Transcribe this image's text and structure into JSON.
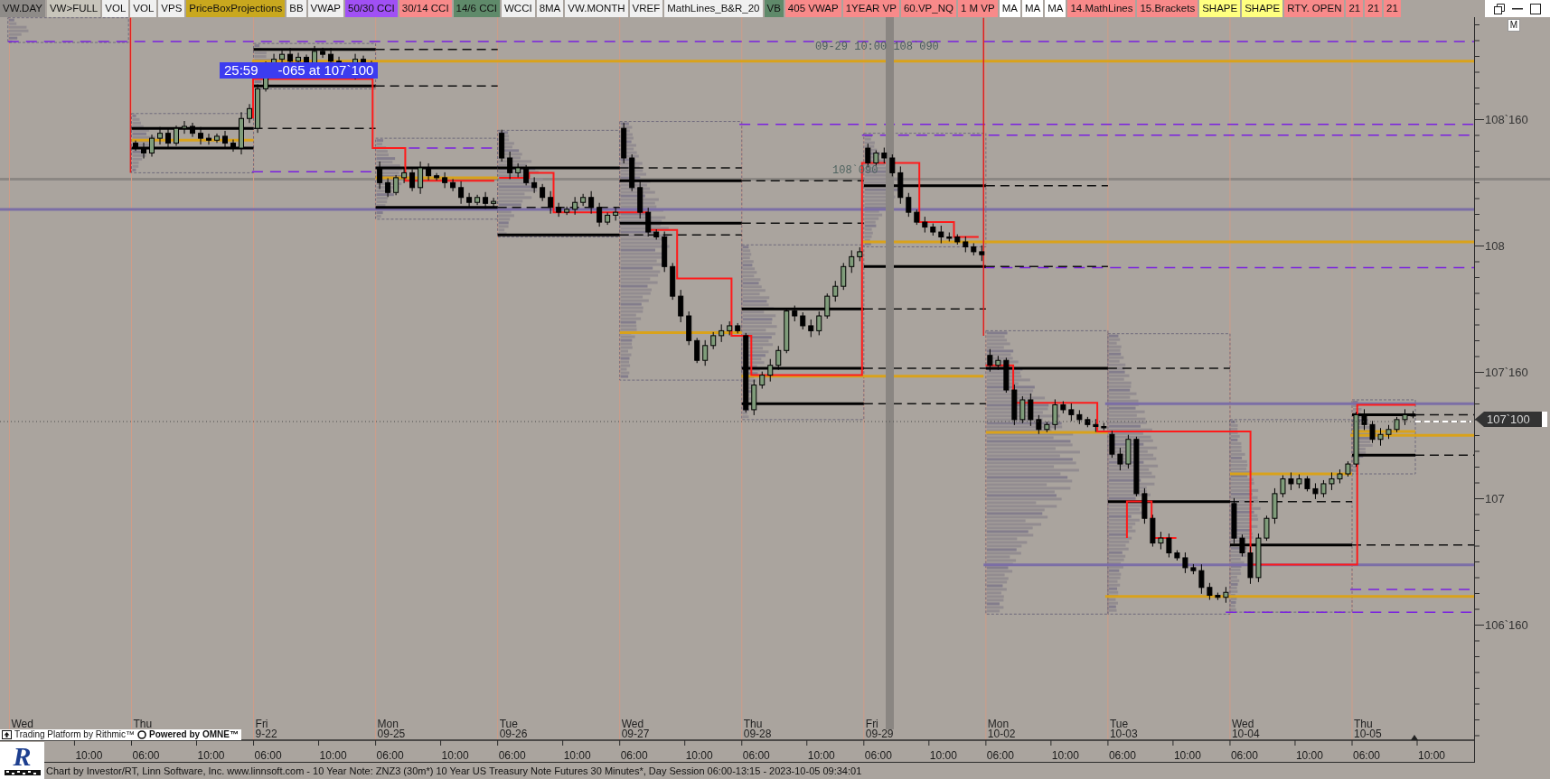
{
  "toolbar": {
    "buttons": [
      {
        "label": "VW.DAY",
        "color": "#8e8b88"
      },
      {
        "label": "VW>FULL",
        "color": "#c8c5bb"
      },
      {
        "label": "VOL",
        "color": "#f0f0f0"
      },
      {
        "label": "VOL",
        "color": "#f0f0f0"
      },
      {
        "label": "VPS",
        "color": "#f0f0f0"
      },
      {
        "label": "PriceBoxProjections",
        "color": "#c9a81e"
      },
      {
        "label": "BB",
        "color": "#f0f0f0"
      },
      {
        "label": "VWAP",
        "color": "#f0f0f0"
      },
      {
        "label": "50/30 CCI",
        "color": "#a050f5"
      },
      {
        "label": "30/14 CCI",
        "color": "#f88a8a"
      },
      {
        "label": "14/6 CCI",
        "color": "#5f8a6a"
      },
      {
        "label": "WCCI",
        "color": "#f0f0f0"
      },
      {
        "label": "8MA",
        "color": "#f0f0f0"
      },
      {
        "label": "VW.MONTH",
        "color": "#f0f0f0"
      },
      {
        "label": "VREF",
        "color": "#f0f0f0"
      },
      {
        "label": "MathLines_B&R_20",
        "color": "#f0f0f0"
      },
      {
        "label": "VB",
        "color": "#5f8a6a"
      },
      {
        "label": "405 VWAP",
        "color": "#f88a8a"
      },
      {
        "label": "1YEAR VP",
        "color": "#f88a8a"
      },
      {
        "label": "60.VP_NQ",
        "color": "#f88a8a"
      },
      {
        "label": "1 M VP",
        "color": "#f88a8a"
      },
      {
        "label": "MA",
        "color": "#ffffff"
      },
      {
        "label": "MA",
        "color": "#ffffff"
      },
      {
        "label": "MA",
        "color": "#ffffff"
      },
      {
        "label": "14.MathLines",
        "color": "#f88a8a"
      },
      {
        "label": "15.Brackets",
        "color": "#f88a8a"
      },
      {
        "label": "SHAPE",
        "color": "#ffff80"
      },
      {
        "label": "SHAPE",
        "color": "#ffff80"
      },
      {
        "label": "RTY. OPEN",
        "color": "#f88a8a"
      },
      {
        "label": "21",
        "color": "#f88a8a"
      },
      {
        "label": "21",
        "color": "#f88a8a"
      },
      {
        "label": "21",
        "color": "#f88a8a"
      }
    ]
  },
  "chart": {
    "countdown_label": {
      "time": "25:59",
      "text": "-065 at 107`100"
    },
    "annotations": [
      "09-29 10:00 108`090",
      "108`090"
    ]
  },
  "price_axis": {
    "button": "M",
    "labels": [
      "108`160",
      "108",
      "107`160",
      "107",
      "106`160"
    ],
    "current_price": "107`100"
  },
  "time_axis": {
    "days": [
      {
        "day": "Wed"
      },
      {
        "day": "Thu"
      },
      {
        "day": "Fri",
        "date": "9-22"
      },
      {
        "day": "Mon",
        "date": "09-25"
      },
      {
        "day": "Tue",
        "date": "09-26"
      },
      {
        "day": "Wed",
        "date": "09-27"
      },
      {
        "day": "Thu",
        "date": "09-28"
      },
      {
        "day": "Fri",
        "date": "09-29"
      },
      {
        "day": "Mon",
        "date": "10-02"
      },
      {
        "day": "Tue",
        "date": "10-03"
      },
      {
        "day": "Wed",
        "date": "10-04"
      },
      {
        "day": "Thu",
        "date": "10-05"
      }
    ],
    "times": [
      "10:00",
      "06:00",
      "10:00",
      "06:00",
      "10:00",
      "06:00",
      "10:00",
      "06:00",
      "10:00",
      "06:00",
      "10:00",
      "06:00",
      "10:00",
      "06:00",
      "10:00",
      "06:00",
      "10:00",
      "06:00",
      "10:00",
      "06:00",
      "10:00",
      "06:00",
      "10:00"
    ]
  },
  "branding": {
    "platform": "Trading Platform by Rithmic™",
    "powered": "Powered by OMNE™",
    "logo": "R"
  },
  "footer": {
    "text": "Chart by Investor/RT, Linn Software, Inc. www.linnsoft.com - 10 Year Note: ZNZ3 (30m*) 10 Year US Treasury Note Futures 30 Minutes*, Day Session 06:00-13:15 - 2023-10-05 09:34:01"
  }
}
